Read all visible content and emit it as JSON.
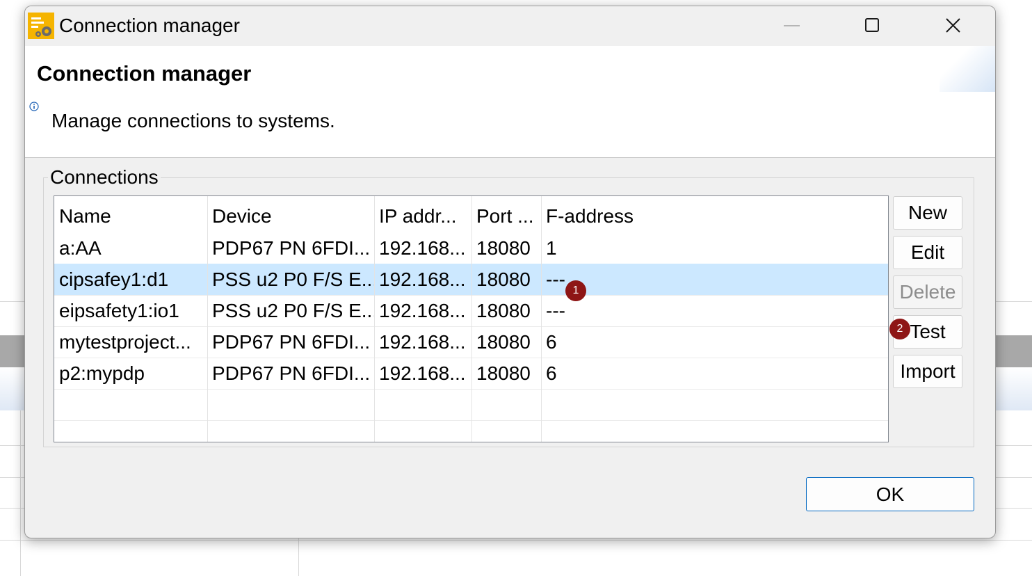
{
  "window": {
    "title": "Connection manager",
    "controls": {
      "minimize": "minimize-icon",
      "maximize": "maximize-icon",
      "close": "close-icon"
    }
  },
  "banner": {
    "title": "Connection manager",
    "message": "Manage connections to systems."
  },
  "group": {
    "label": "Connections"
  },
  "table": {
    "columns": [
      "Name",
      "Device",
      "IP addr...",
      "Port ...",
      "F-address"
    ],
    "rows": [
      {
        "name": "a:AA",
        "device": "PDP67 PN 6FDI...",
        "ip": "192.168...",
        "port": "18080",
        "faddress": "1",
        "selected": false
      },
      {
        "name": "cipsafey1:d1",
        "device": "PSS u2 P0 F/S E...",
        "ip": "192.168...",
        "port": "18080",
        "faddress": "---",
        "selected": true
      },
      {
        "name": "eipsafety1:io1",
        "device": "PSS u2 P0 F/S E...",
        "ip": "192.168...",
        "port": "18080",
        "faddress": "---",
        "selected": false
      },
      {
        "name": "mytestproject...",
        "device": "PDP67 PN 6FDI...",
        "ip": "192.168...",
        "port": "18080",
        "faddress": "6",
        "selected": false
      },
      {
        "name": "p2:mypdp",
        "device": "PDP67 PN 6FDI...",
        "ip": "192.168...",
        "port": "18080",
        "faddress": "6",
        "selected": false
      }
    ]
  },
  "buttons": {
    "new": "New",
    "edit": "Edit",
    "delete": "Delete",
    "test": "Test",
    "import": "Import",
    "ok": "OK"
  },
  "markers": {
    "m1": "1",
    "m2": "2"
  },
  "colors": {
    "selection": "#cce8ff",
    "marker": "#8e1616",
    "ok_border": "#0067c0"
  }
}
